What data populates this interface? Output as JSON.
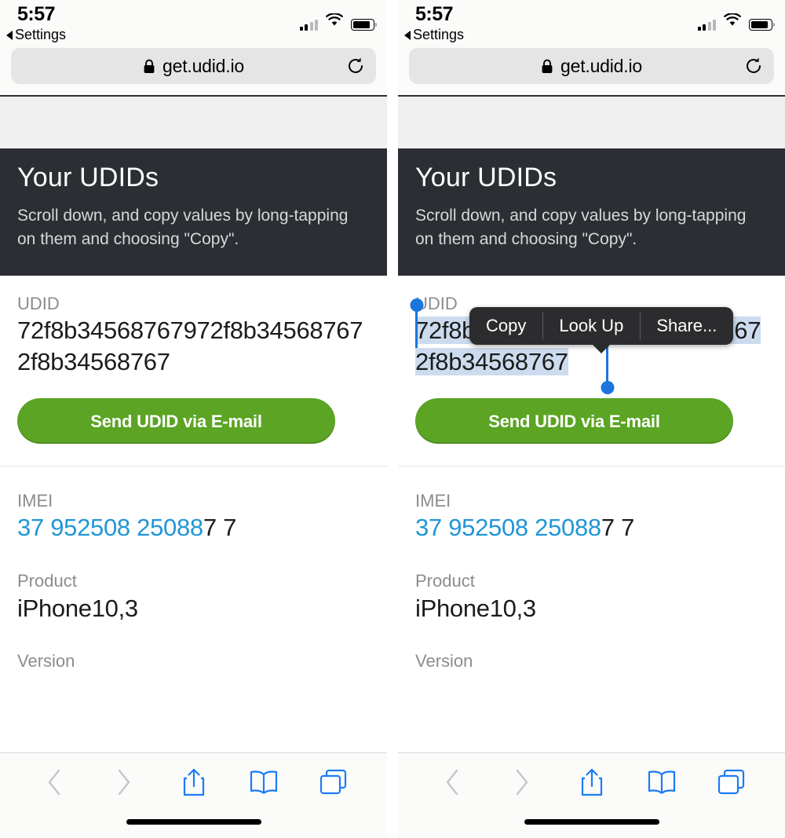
{
  "status_bar": {
    "time": "5:57",
    "back_label": "Settings",
    "back_icon": "triangle-left-icon",
    "signal_icon": "cellular-signal-icon",
    "wifi_icon": "wifi-icon",
    "battery_icon": "battery-icon"
  },
  "browser": {
    "url": "get.udid.io",
    "lock_icon": "lock-icon",
    "reload_icon": "reload-icon",
    "toolbar": {
      "back_icon": "chevron-left-icon",
      "forward_icon": "chevron-right-icon",
      "share_icon": "share-icon",
      "bookmarks_icon": "book-icon",
      "tabs_icon": "tabs-icon"
    }
  },
  "page": {
    "hero": {
      "title": "Your UDIDs",
      "subtitle": "Scroll down, and copy values by long-tapping on them and choosing \"Copy\"."
    },
    "udid": {
      "label": "UDID",
      "value": "72f8b34568767972f8b345687672f8b34568767",
      "button_label": "Send UDID via E-mail"
    },
    "imei": {
      "label": "IMEI",
      "tel_part": "37 952508 25088",
      "plain_part": "7 7"
    },
    "product": {
      "label": "Product",
      "value": "iPhone10,3"
    },
    "version": {
      "label": "Version"
    }
  },
  "selection_callout": {
    "items": [
      {
        "label": "Copy"
      },
      {
        "label": "Look Up"
      },
      {
        "label": "Share..."
      }
    ]
  },
  "colors": {
    "hero_bg": "#2b2e33",
    "button_green": "#5ba424",
    "tel_link": "#2196d6",
    "selection_highlight": "#ccdcee",
    "selection_handle": "#1a76dc",
    "toolbar_icon": "#1a7cf5",
    "callout_bg": "#2c2c2e"
  }
}
